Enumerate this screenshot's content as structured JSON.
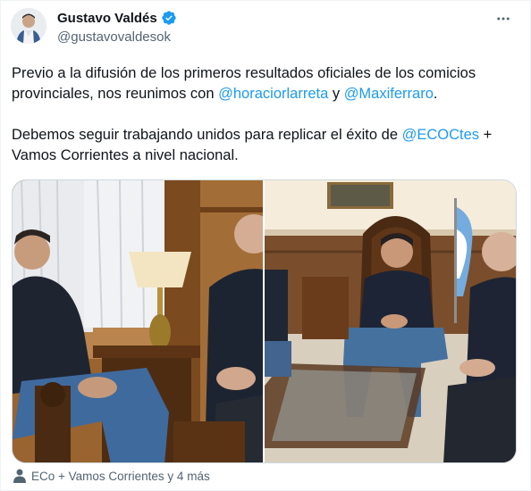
{
  "author": {
    "name": "Gustavo Valdés",
    "handle": "@gustavovaldesok",
    "verified": true,
    "avatar_icon": "user-avatar"
  },
  "more_icon": "more-horizontal-icon",
  "tweet": {
    "p1": {
      "text_a": "Previo a la difusión de los primeros resultados oficiales de los comicios provinciales, nos reunimos con ",
      "mention_1": "@horaciorlarreta",
      "text_b": " y ",
      "mention_2": "@Maxiferraro",
      "text_c": "."
    },
    "p2": {
      "text_a": "Debemos seguir trabajando unidos para replicar el éxito de ",
      "mention_1": "@ECOCtes",
      "text_b": " + Vamos Corrientes a nivel nacional."
    }
  },
  "media": {
    "photo_count": 2
  },
  "tagged": {
    "icon": "person-icon",
    "text": "ECo + Vamos Corrientes y 4 más"
  },
  "colors": {
    "link": "#1d9bf0",
    "verified": "#1d9bf0",
    "secondary_text": "#536471"
  }
}
